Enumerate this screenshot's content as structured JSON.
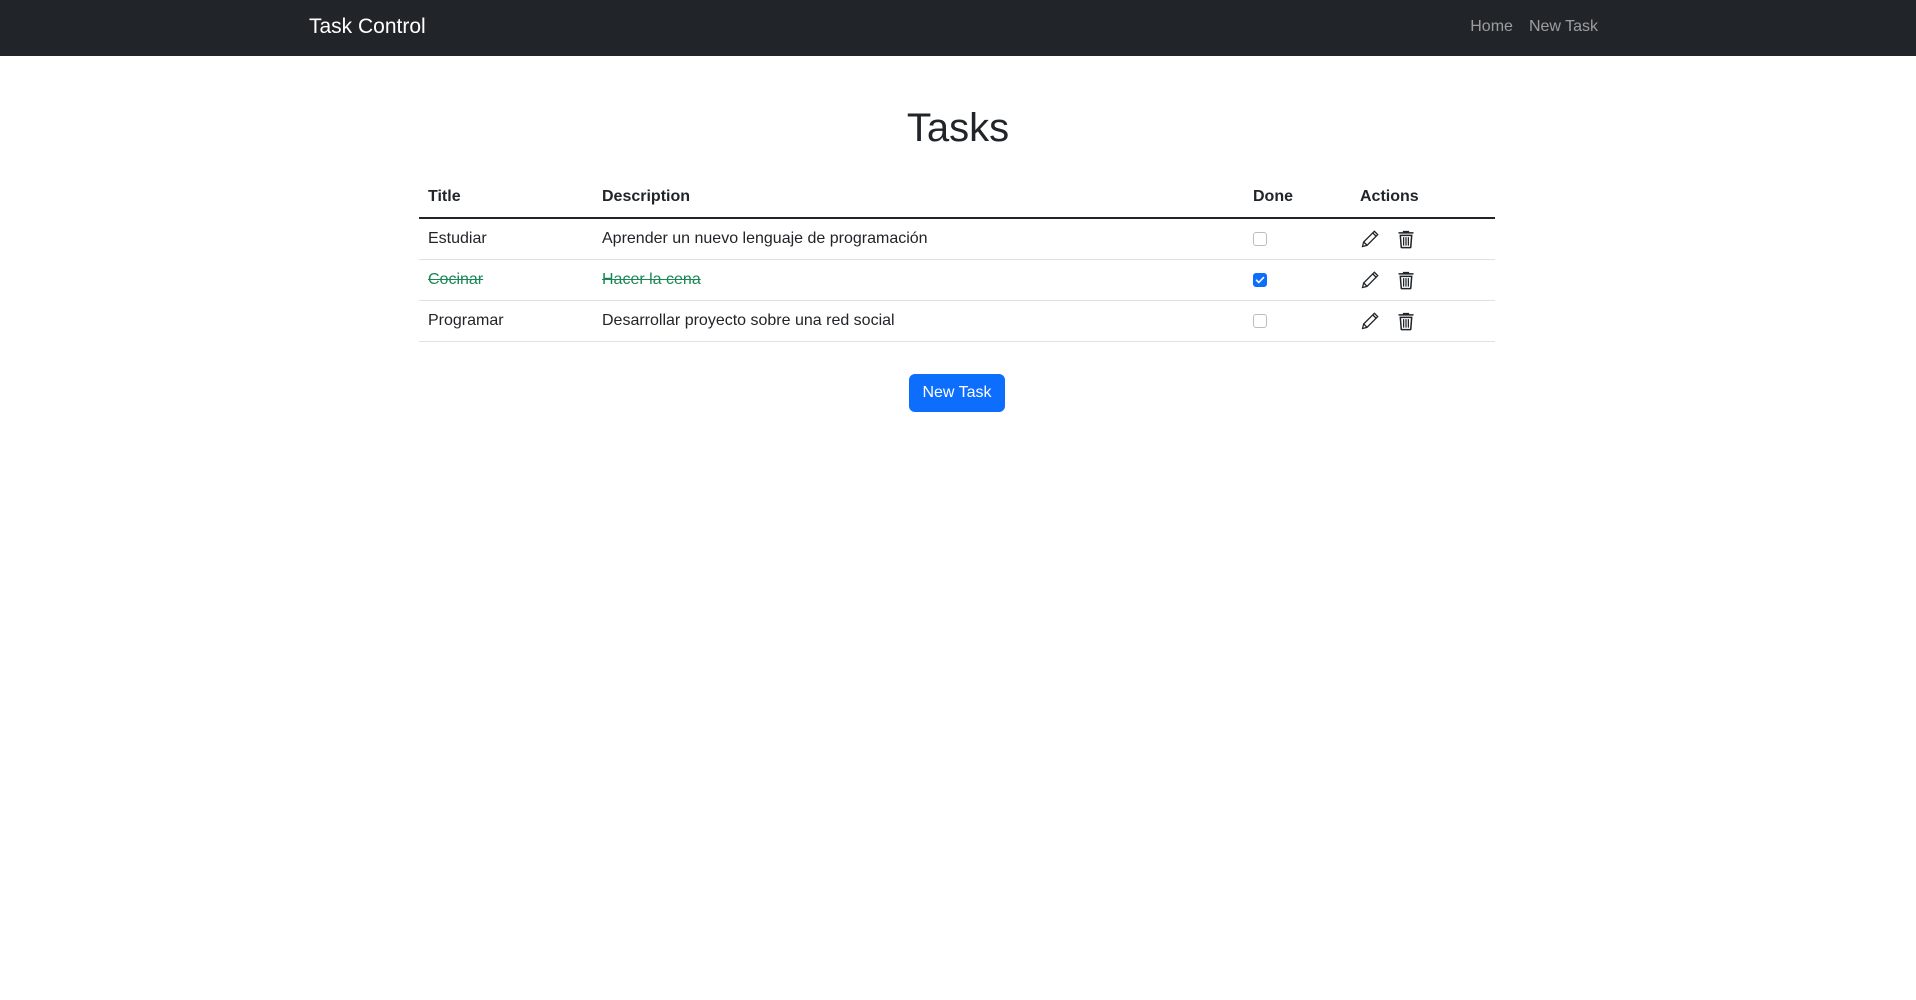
{
  "navbar": {
    "brand": "Task Control",
    "links": [
      "Home",
      "New Task"
    ]
  },
  "page": {
    "title": "Tasks"
  },
  "table": {
    "headers": [
      "Title",
      "Description",
      "Done",
      "Actions"
    ],
    "rows": [
      {
        "title": "Estudiar",
        "description": "Aprender un nuevo lenguaje de programación",
        "done": false
      },
      {
        "title": "Cocinar",
        "description": "Hacer la cena",
        "done": true
      },
      {
        "title": "Programar",
        "description": "Desarrollar proyecto sobre una red social",
        "done": false
      }
    ],
    "action_icons": [
      "pencil-icon",
      "trash-icon"
    ]
  },
  "footer_button": {
    "label": "New Task"
  },
  "colors": {
    "navbar_bg": "#212529",
    "accent": "#0d6efd",
    "done_text": "#198754"
  }
}
